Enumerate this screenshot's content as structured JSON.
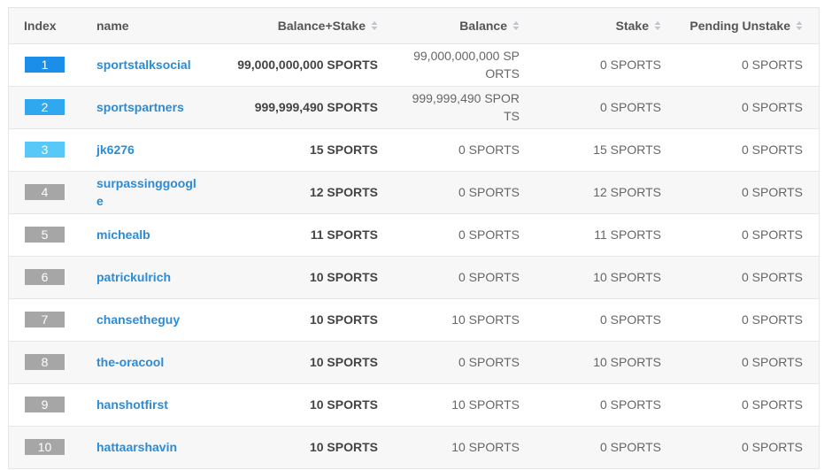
{
  "colors": {
    "link": "#2b8bd6",
    "badge_rank1": "#1a8ee8",
    "badge_rank2": "#30a8f0",
    "badge_rank3": "#57c8f7",
    "badge_default": "#a6a6a6"
  },
  "table": {
    "headers": {
      "index": "Index",
      "name": "name",
      "total": "Balance+Stake",
      "balance": "Balance",
      "stake": "Stake",
      "pending": "Pending Unstake"
    },
    "rows": [
      {
        "index": "1",
        "name": "sportstalksocial",
        "total": "99,000,000,000 SPORTS",
        "balance": "99,000,000,000 SPORTS",
        "stake": "0 SPORTS",
        "pending": "0 SPORTS"
      },
      {
        "index": "2",
        "name": "sportspartners",
        "total": "999,999,490 SPORTS",
        "balance": "999,999,490 SPORTS",
        "stake": "0 SPORTS",
        "pending": "0 SPORTS"
      },
      {
        "index": "3",
        "name": "jk6276",
        "total": "15 SPORTS",
        "balance": "0 SPORTS",
        "stake": "15 SPORTS",
        "pending": "0 SPORTS"
      },
      {
        "index": "4",
        "name": "surpassinggoogle",
        "total": "12 SPORTS",
        "balance": "0 SPORTS",
        "stake": "12 SPORTS",
        "pending": "0 SPORTS"
      },
      {
        "index": "5",
        "name": "michealb",
        "total": "11 SPORTS",
        "balance": "0 SPORTS",
        "stake": "11 SPORTS",
        "pending": "0 SPORTS"
      },
      {
        "index": "6",
        "name": "patrickulrich",
        "total": "10 SPORTS",
        "balance": "0 SPORTS",
        "stake": "10 SPORTS",
        "pending": "0 SPORTS"
      },
      {
        "index": "7",
        "name": "chansetheguy",
        "total": "10 SPORTS",
        "balance": "10 SPORTS",
        "stake": "0 SPORTS",
        "pending": "0 SPORTS"
      },
      {
        "index": "8",
        "name": "the-oracool",
        "total": "10 SPORTS",
        "balance": "0 SPORTS",
        "stake": "10 SPORTS",
        "pending": "0 SPORTS"
      },
      {
        "index": "9",
        "name": "hanshotfirst",
        "total": "10 SPORTS",
        "balance": "10 SPORTS",
        "stake": "0 SPORTS",
        "pending": "0 SPORTS"
      },
      {
        "index": "10",
        "name": "hattaarshavin",
        "total": "10 SPORTS",
        "balance": "10 SPORTS",
        "stake": "0 SPORTS",
        "pending": "0 SPORTS"
      }
    ]
  }
}
